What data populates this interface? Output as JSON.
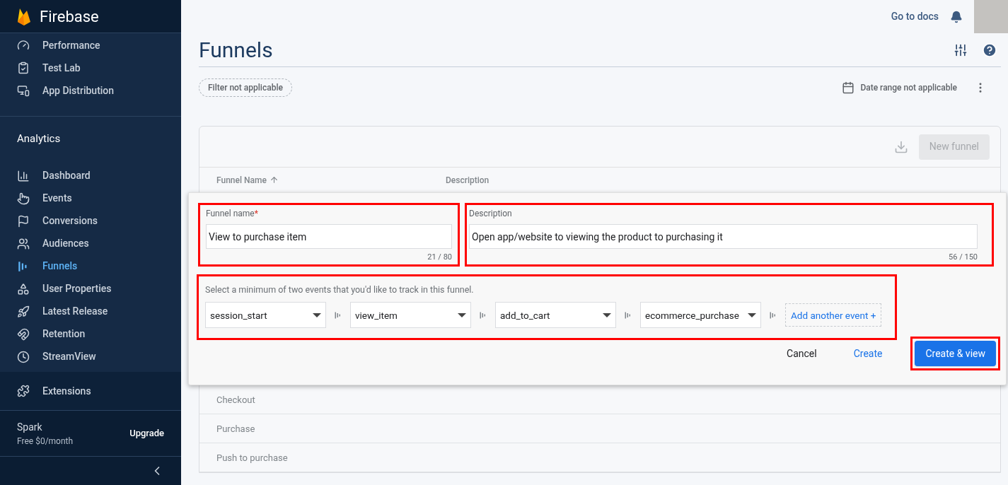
{
  "sidebar": {
    "brand": "Firebase",
    "top_items": [
      {
        "label": "Performance",
        "selected": false
      },
      {
        "label": "Test Lab",
        "selected": false
      },
      {
        "label": "App Distribution",
        "selected": false
      }
    ],
    "section_title": "Analytics",
    "items": [
      {
        "label": "Dashboard",
        "selected": false
      },
      {
        "label": "Events",
        "selected": false
      },
      {
        "label": "Conversions",
        "selected": false
      },
      {
        "label": "Audiences",
        "selected": false
      },
      {
        "label": "Funnels",
        "selected": true
      },
      {
        "label": "User Properties",
        "selected": false
      },
      {
        "label": "Latest Release",
        "selected": false
      },
      {
        "label": "Retention",
        "selected": false
      },
      {
        "label": "StreamView",
        "selected": false
      }
    ],
    "extensions": "Extensions",
    "plan": {
      "name": "Spark",
      "price": "Free $0/month",
      "action": "Upgrade"
    }
  },
  "topbar": {
    "docs_link": "Go to docs"
  },
  "page": {
    "title": "Funnels",
    "filter_chip": "Filter not applicable",
    "date_range": "Date range not applicable"
  },
  "table": {
    "new_button": {
      "label": "New funnel",
      "disabled": true
    },
    "columns": [
      "Funnel Name",
      "Description"
    ],
    "rows": [
      {
        "name": "Checkout"
      },
      {
        "name": "Purchase"
      },
      {
        "name": "Push to purchase"
      }
    ]
  },
  "dialog": {
    "funnel_name": {
      "label": "Funnel name",
      "required_mark": "*",
      "value": "View to purchase item",
      "counter": "21 / 80",
      "highlighted": true
    },
    "description": {
      "label": "Description",
      "value": "Open app/website to viewing the product to purchasing it",
      "counter": "56 / 150",
      "highlighted": true
    },
    "events": {
      "hint": "Select a minimum of two events that you'd like to track in this funnel.",
      "highlighted": true,
      "steps": [
        {
          "value": "session_start"
        },
        {
          "value": "view_item"
        },
        {
          "value": "add_to_cart"
        },
        {
          "value": "ecommerce_purchase"
        }
      ],
      "add_button": "Add another event +"
    },
    "buttons": [
      {
        "label": "Cancel",
        "kind": "text"
      },
      {
        "label": "Create",
        "kind": "link"
      },
      {
        "label": "Create & view",
        "kind": "primary",
        "highlighted": true
      }
    ]
  }
}
